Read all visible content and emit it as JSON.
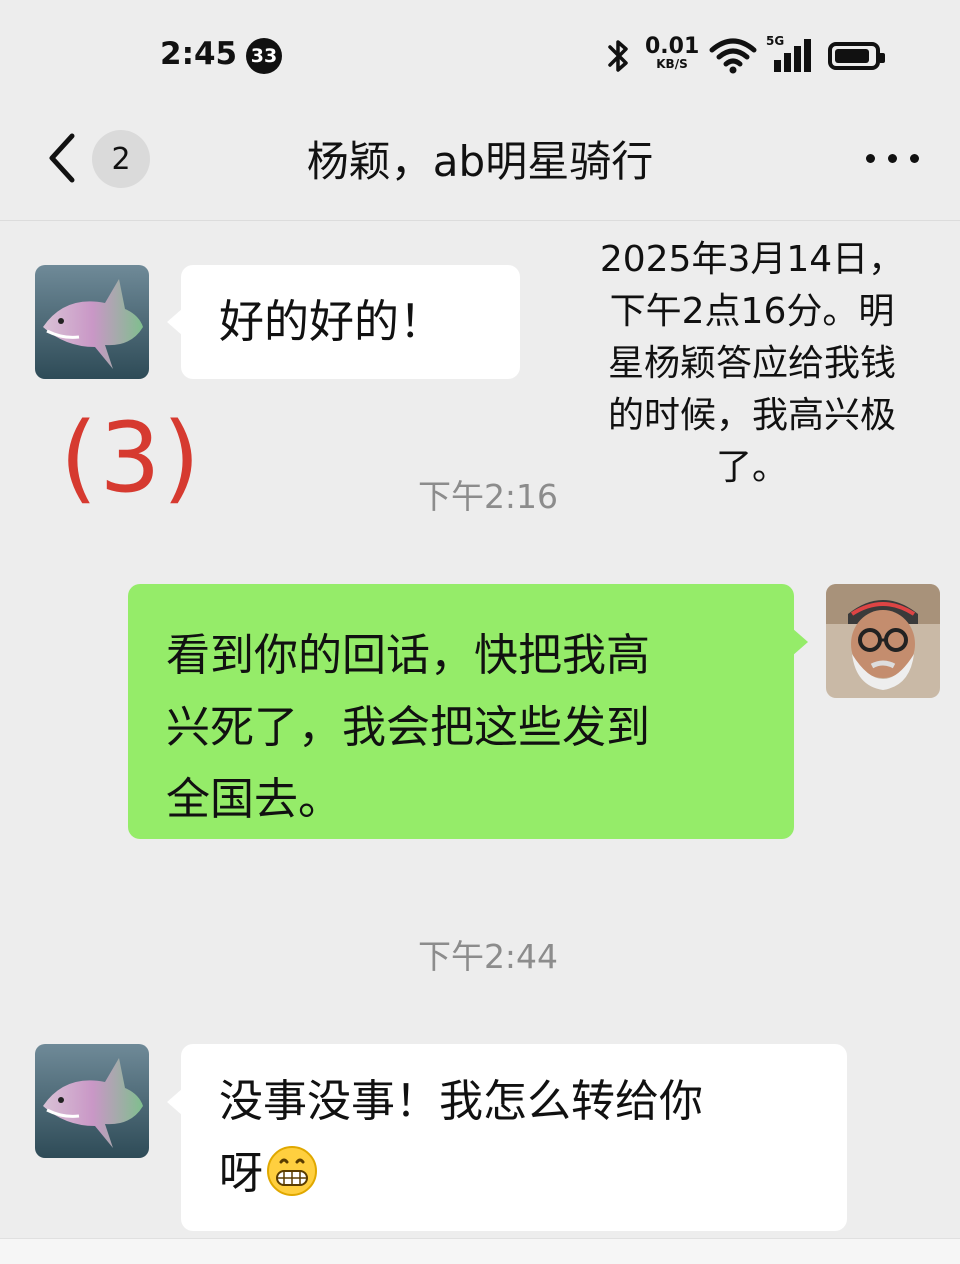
{
  "status_bar": {
    "time": "2:45",
    "notification_count": "33",
    "net_speed_value": "0.01",
    "net_speed_unit": "KB/S",
    "network_type": "5G",
    "icons": [
      "bluetooth-icon",
      "wifi-icon",
      "signal-icon",
      "battery-icon"
    ]
  },
  "nav": {
    "unread_count": "2",
    "title": "杨颖，ab明星骑行",
    "icons": [
      "back-chevron-icon",
      "more-icon"
    ]
  },
  "annotation": {
    "lines": [
      "2025年3月14日，",
      "下午2点16分。明",
      "星杨颖答应给我钱",
      "的时候，我高兴极",
      "了。"
    ]
  },
  "marker": "(3)",
  "messages": [
    {
      "type": "incoming",
      "text": "好的好的！",
      "avatar": "shark-avatar"
    },
    {
      "type": "timestamp",
      "text": "下午2:16"
    },
    {
      "type": "outgoing",
      "lines": [
        "看到你的回话，快把我高",
        "兴死了，我会把这些发到",
        "全国去。"
      ],
      "avatar": "old-man-glasses-avatar"
    },
    {
      "type": "timestamp",
      "text": "下午2:44"
    },
    {
      "type": "incoming",
      "lines": [
        "没事没事！我怎么转给你",
        "呀"
      ],
      "emoji": "grinning-face-icon",
      "avatar": "shark-avatar"
    }
  ],
  "colors": {
    "background": "#ededed",
    "incoming_bubble": "#ffffff",
    "outgoing_bubble": "#95ec69",
    "marker": "#d63a30",
    "timestamp": "#8c8c8c"
  }
}
